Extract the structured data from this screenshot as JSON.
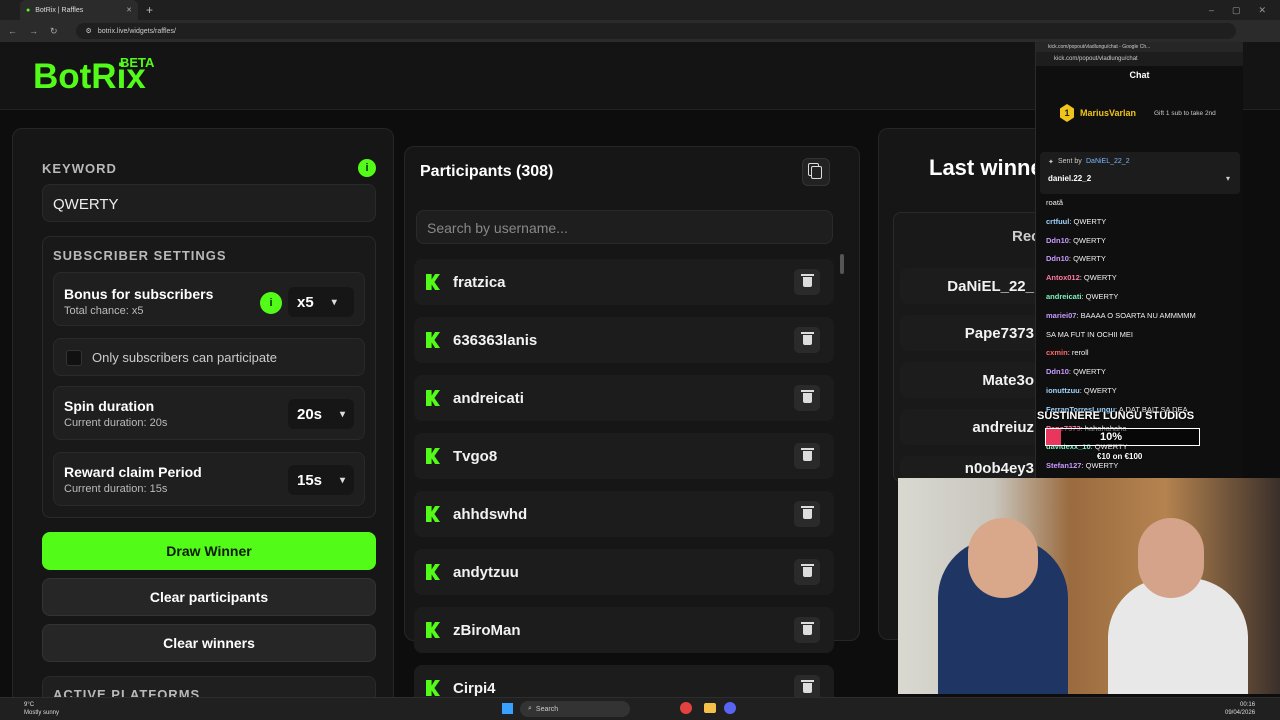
{
  "browser": {
    "tab_title": "BotRix | Raffles",
    "url": "botrix.live/widgets/raffles/"
  },
  "header": {
    "logo": "BotRix",
    "badge": "BETA"
  },
  "keyword": {
    "label": "KEYWORD",
    "value": "QWERTY",
    "info": "i"
  },
  "subscriber": {
    "title": "SUBSCRIBER SETTINGS",
    "bonus_label": "Bonus for subscribers",
    "bonus_sub": "Total chance: x5",
    "bonus_value": "x5",
    "info": "i",
    "only_subs": "Only subscribers can participate",
    "spin_label": "Spin duration",
    "spin_sub": "Current duration: 20s",
    "spin_value": "20s",
    "reward_label": "Reward claim Period",
    "reward_sub": "Current duration: 15s",
    "reward_value": "15s"
  },
  "buttons": {
    "draw": "Draw Winner",
    "clear_participants": "Clear participants",
    "clear_winners": "Clear winners"
  },
  "active_platforms": "ACTIVE PLATFORMS",
  "participants": {
    "title": "Participants (308)",
    "search_placeholder": "Search by username...",
    "items": [
      "fratzica",
      "636363lanis",
      "andreicati",
      "Tvgo8",
      "ahhdswhd",
      "andytzuu",
      "zBiroMan",
      "Cirpi4"
    ]
  },
  "winners": {
    "title": "Last winne",
    "sub": "Rec",
    "items": [
      "DaNiEL_22_",
      "Pape7373",
      "Mate3o",
      "andreiuz",
      "n0ob4ey3"
    ]
  },
  "chat": {
    "window_title": "kick.com/popout/vladlungu/chat - Google Ch...",
    "url": "kick.com/popout/vladlungu/chat",
    "title": "Chat",
    "top_user": "MariusVarlan",
    "top_rank": "1",
    "gift_text": "Gift 1 sub to take 2nd",
    "pinned_by_label": "Sent by",
    "pinned_by": "DaNiEL_22_2",
    "pinned_user": "daniel.22_2",
    "messages": [
      {
        "user": "",
        "text": "roată",
        "color": "#ffffff"
      },
      {
        "user": "crtfuul",
        "text": ": QWERTY",
        "color": "#9fd3ff"
      },
      {
        "user": "Ddn10",
        "text": ": QWERTY",
        "color": "#c89bff"
      },
      {
        "user": "Ddn10",
        "text": ": QWERTY",
        "color": "#c89bff"
      },
      {
        "user": "Antox012",
        "text": ": QWERTY",
        "color": "#ff7aa2"
      },
      {
        "user": "andreicati",
        "text": ": QWERTY",
        "color": "#7ff0c0"
      },
      {
        "user": "mariei07",
        "text": ": BAAAA O SOARTA NU AMMMMM",
        "color": "#c89bff"
      },
      {
        "user": "",
        "text": "SA MA FUT IN OCHII MEI",
        "color": "#ffffff"
      },
      {
        "user": "cxmin",
        "text": ": reroll",
        "color": "#ff6b6b"
      },
      {
        "user": "Ddn10",
        "text": ": QWERTY",
        "color": "#c89bff"
      },
      {
        "user": "ionuttzuu",
        "text": ": QWERTY",
        "color": "#9fd3ff"
      },
      {
        "user": "FerranTorresLungu",
        "text": ": A DAT BAIT SA DEA",
        "color": "#9fd3ff"
      },
      {
        "user": "Pape7373",
        "text": ": hahahahaha",
        "color": "#ff7aa2"
      },
      {
        "user": "davidexx_10",
        "text": ": QWERTY",
        "color": "#7ff0c0"
      },
      {
        "user": "Stefan127",
        "text": ": QWERTY",
        "color": "#c89bff"
      }
    ]
  },
  "overlay": {
    "title": "SUSTINERE LUNGU STUDIOS",
    "percent": "10%",
    "goal": "€10 on €100",
    "progress": 0.1
  },
  "taskbar": {
    "weather_temp": "9°C",
    "weather_text": "Mostly sunny",
    "search": "Search",
    "time": "00:16",
    "date": "09/04/2026"
  }
}
